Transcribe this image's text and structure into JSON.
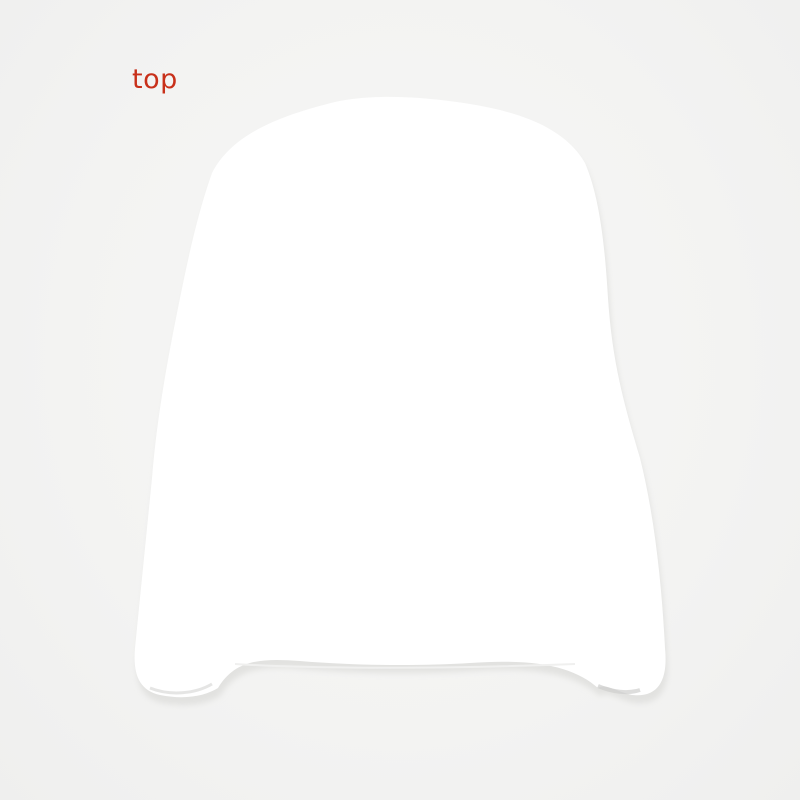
{
  "label": {
    "text": "top",
    "color": "#c8301a"
  },
  "garment": {
    "name": "white-sweater",
    "color": "#ffffff",
    "shadow_color": "#dcdcda"
  },
  "background_color": "#f4f4f3"
}
